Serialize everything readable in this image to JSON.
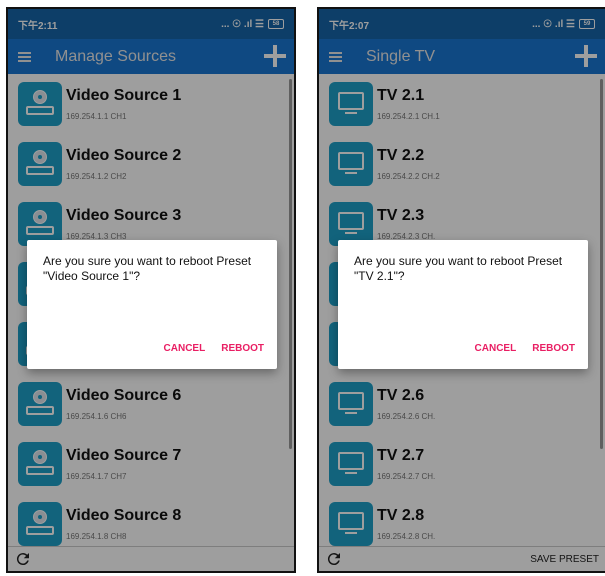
{
  "colors": {
    "status_bar": "#1565a8",
    "app_bar": "#1976d2",
    "tile": "#1da1c8",
    "accent": "#e91e63"
  },
  "left_screen": {
    "status_time": "下午2:11",
    "status_icons": "... ☉ .ıl ☰",
    "battery": "58",
    "app_title": "Manage Sources",
    "items": [
      {
        "name": "Video Source 1",
        "sub": "169.254.1.1  CH1",
        "icon": "video-source-icon"
      },
      {
        "name": "Video Source 2",
        "sub": "169.254.1.2  CH2",
        "icon": "video-source-icon"
      },
      {
        "name": "Video Source 3",
        "sub": "169.254.1.3  CH3",
        "icon": "video-source-icon"
      },
      {
        "name": "",
        "sub": "",
        "icon": "video-source-icon"
      },
      {
        "name": "",
        "sub": "",
        "icon": "video-source-icon"
      },
      {
        "name": "Video Source 6",
        "sub": "169.254.1.6  CH6",
        "icon": "video-source-icon"
      },
      {
        "name": "Video Source 7",
        "sub": "169.254.1.7  CH7",
        "icon": "video-source-icon"
      },
      {
        "name": "Video Source 8",
        "sub": "169.254.1.8  CH8",
        "icon": "video-source-icon"
      }
    ],
    "bottom_label": "",
    "dialog": {
      "message": "Are you sure you want to reboot Preset \"Video Source 1\"?",
      "cancel": "CANCEL",
      "confirm": "REBOOT"
    }
  },
  "right_screen": {
    "status_time": "下午2:07",
    "status_icons": "... ☉ .ıl ☰",
    "battery": "59",
    "app_title": "Single TV",
    "items": [
      {
        "name": "TV 2.1",
        "sub": "169.254.2.1  CH.1",
        "icon": "tv-icon"
      },
      {
        "name": "TV 2.2",
        "sub": "169.254.2.2  CH.2",
        "icon": "tv-icon"
      },
      {
        "name": "TV 2.3",
        "sub": "169.254.2.3  CH.",
        "icon": "tv-icon"
      },
      {
        "name": "",
        "sub": "",
        "icon": "tv-icon"
      },
      {
        "name": "",
        "sub": "",
        "icon": "tv-icon"
      },
      {
        "name": "TV 2.6",
        "sub": "169.254.2.6  CH.",
        "icon": "tv-icon"
      },
      {
        "name": "TV 2.7",
        "sub": "169.254.2.7  CH.",
        "icon": "tv-icon"
      },
      {
        "name": "TV 2.8",
        "sub": "169.254.2.8  CH.",
        "icon": "tv-icon"
      }
    ],
    "bottom_label": "SAVE PRESET",
    "dialog": {
      "message": "Are you sure you want to reboot Preset \"TV 2.1\"?",
      "cancel": "CANCEL",
      "confirm": "REBOOT"
    }
  }
}
